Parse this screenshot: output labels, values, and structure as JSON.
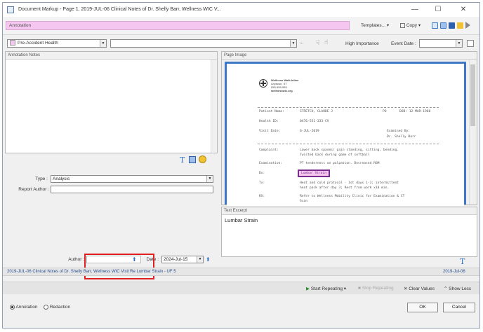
{
  "window": {
    "title": "Document Markup - Page 1, 2019-JUL-06 Clinical Notes of Dr. Shelly Barr, Wellness WIC V...",
    "minimize": "—",
    "maximize": "☐",
    "close": "✕"
  },
  "toolbar": {
    "annotation_banner": "Annotation",
    "templates_label": "Templates...",
    "copy_label": "Copy"
  },
  "row2": {
    "category_value": "Pre-Accident Health",
    "description_value": "",
    "ellipsis": "...",
    "priority_label": "High Importance",
    "event_date_label": "Event Date :",
    "event_date_value": ""
  },
  "annotation_notes": {
    "header": "Annotation Notes",
    "text": ""
  },
  "page_image": {
    "header": "Page Image",
    "letterhead": {
      "org_name": "Wellness Walk-Inline",
      "line2": "Anytown, ST",
      "line3": "555-555-555",
      "line4": "wellnesswic.org"
    },
    "rows": [
      {
        "label": "Patient Name:",
        "value": "STRETCH, CLAUDE J",
        "label2": "PO",
        "value2": "DOB: 12-MAR-1960"
      },
      {
        "label": "Health ID:",
        "value": "0476-551-333-CV",
        "label2": "",
        "value2": ""
      },
      {
        "label": "Visit Date:",
        "value": "6-JUL-2019",
        "label2": "Examined By:",
        "value2": "Dr. Shelly Barr"
      }
    ],
    "complaint_label": "Complaint:",
    "complaint_text_1": "Lower back spasms/ pain standing, sitting, bending.",
    "complaint_text_2": "Twisted back during game of softball",
    "exam_label": "Examination:",
    "exam_text": "PT tenderness on palpation. Decreased ROM",
    "dx_label": "Dx:",
    "dx_text": "Lumbar Strain",
    "tx_label": "Tx:",
    "tx_text_1": "Heat and cold protocol - 1st days 1-3; intermittent",
    "tx_text_2": "heat pack after day 3; Rest from work x10 min.",
    "rx_label": "RX:",
    "rx_text_1": "Refer to Wellness Mobility Clinic for Examination & CT",
    "rx_text_2": "Scan"
  },
  "text_excerpt": {
    "header": "Text Excerpt",
    "text": "Lumbar Strain"
  },
  "form": {
    "type_label": "Type :",
    "type_value": "Analysis",
    "report_author_label": "Report Author :",
    "report_author_value": "",
    "author_label": "Author :",
    "author_value": "",
    "date_label": "Date :",
    "date_value": "2024-Jul-15"
  },
  "status": {
    "left": "2019-JUL-06 Clinical Notes of Dr. Shelly Barr, Wellness WIC Visit Re Lumbar Strain - UF 5",
    "right": "2019-Jul-06"
  },
  "bottom_toolbar": {
    "start_repeating": "Start Repeating",
    "stop_repeating": "Stop Repeating",
    "clear_values": "Clear Values",
    "show_less": "Show Less"
  },
  "footer": {
    "annotation_radio": "Annotation",
    "redaction_radio": "Redaction",
    "ok": "OK",
    "cancel": "Cancel"
  },
  "colors": {
    "annotation_pink": "#f5c6f0",
    "highlight_purple": "#7a2f8e",
    "callout_red": "#e02020",
    "link_blue": "#2a4f8e"
  }
}
